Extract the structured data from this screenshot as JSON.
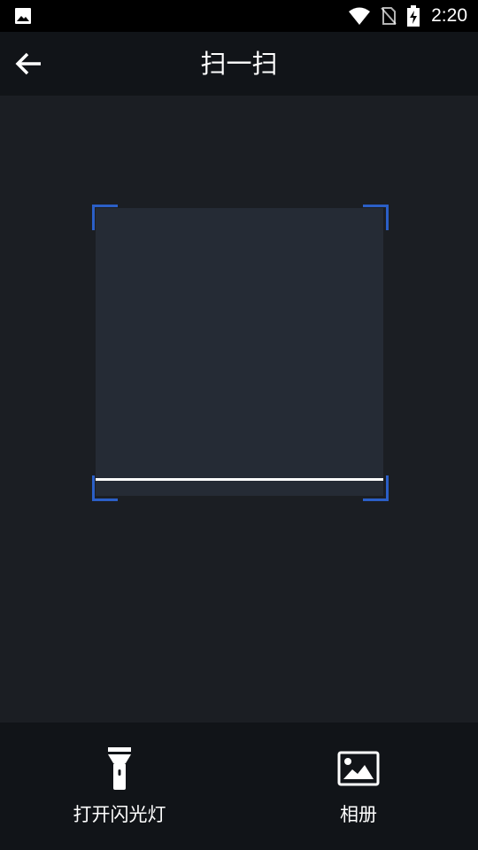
{
  "status_bar": {
    "time": "2:20",
    "icons": [
      "image-notification-icon",
      "wifi-icon",
      "no-sim-icon",
      "battery-charging-icon"
    ]
  },
  "app_bar": {
    "title": "扫一扫",
    "back_icon": "arrow-left-icon"
  },
  "scanner": {
    "frame_color": "#252b35",
    "corner_color": "#2b5fc7",
    "line_color": "#ffffff"
  },
  "bottom_bar": {
    "flashlight": {
      "label": "打开闪光灯",
      "icon": "flashlight-icon"
    },
    "album": {
      "label": "相册",
      "icon": "image-gallery-icon"
    }
  }
}
